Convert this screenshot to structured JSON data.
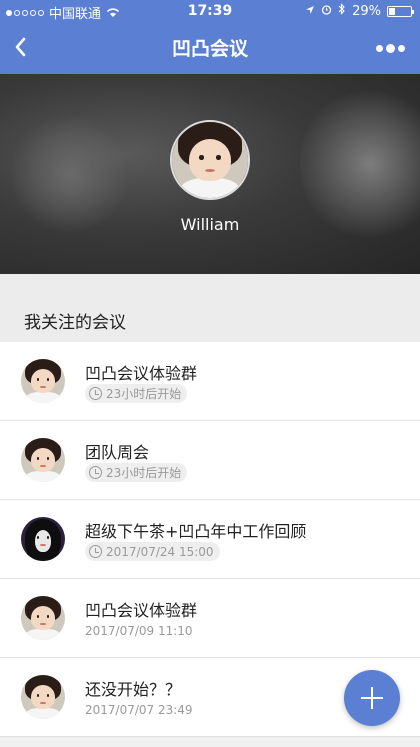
{
  "status_bar": {
    "carrier": "中国联通",
    "time": "17:39",
    "battery": "29%",
    "battery_level": 0.29
  },
  "nav": {
    "title": "凹凸会议",
    "back_icon": "chevron-left-icon",
    "more_icon": "more-dots-icon"
  },
  "profile": {
    "name": "William"
  },
  "section": {
    "title": "我关注的会议"
  },
  "meetings": [
    {
      "title": "凹凸会议体验群",
      "info": "23小时后开始",
      "style": "badge",
      "avatar": "child"
    },
    {
      "title": "团队周会",
      "info": "23小时后开始",
      "style": "badge",
      "avatar": "child"
    },
    {
      "title": "超级下午茶+凹凸年中工作回顾",
      "info": "2017/07/24 15:00",
      "style": "badge",
      "avatar": "dark"
    },
    {
      "title": "凹凸会议体验群",
      "info": "2017/07/09 11:10",
      "style": "plain",
      "avatar": "child"
    },
    {
      "title": "还没开始？？",
      "info": "2017/07/07 23:49",
      "style": "plain",
      "avatar": "child"
    }
  ],
  "colors": {
    "accent": "#5b7fd3"
  }
}
